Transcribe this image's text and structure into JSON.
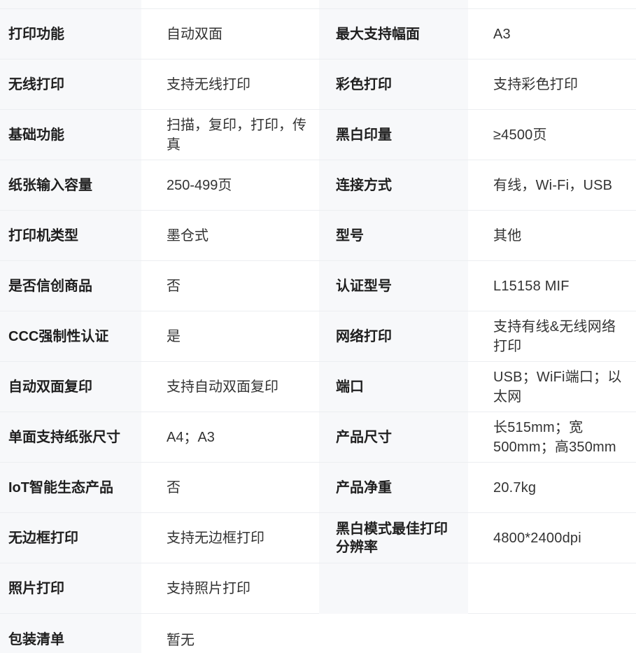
{
  "rows": [
    [
      {
        "label": "打印功能",
        "value": "自动双面"
      },
      {
        "label": "最大支持幅面",
        "value": "A3"
      }
    ],
    [
      {
        "label": "无线打印",
        "value": "支持无线打印"
      },
      {
        "label": "彩色打印",
        "value": "支持彩色打印"
      }
    ],
    [
      {
        "label": "基础功能",
        "value": "扫描，复印，打印，传真"
      },
      {
        "label": "黑白印量",
        "value": "≥4500页"
      }
    ],
    [
      {
        "label": "纸张输入容量",
        "value": "250-499页"
      },
      {
        "label": "连接方式",
        "value": "有线，Wi-Fi，USB"
      }
    ],
    [
      {
        "label": "打印机类型",
        "value": "墨仓式"
      },
      {
        "label": "型号",
        "value": "其他"
      }
    ],
    [
      {
        "label": "是否信创商品",
        "value": "否"
      },
      {
        "label": "认证型号",
        "value": "L15158 MIF"
      }
    ],
    [
      {
        "label": "CCC强制性认证",
        "value": "是"
      },
      {
        "label": "网络打印",
        "value": "支持有线&无线网络打印"
      }
    ],
    [
      {
        "label": "自动双面复印",
        "value": "支持自动双面复印"
      },
      {
        "label": "端口",
        "value": "USB；WiFi端口；以太网"
      }
    ],
    [
      {
        "label": "单面支持纸张尺寸",
        "value": "A4；A3"
      },
      {
        "label": "产品尺寸",
        "value": "长515mm；宽500mm；高350mm"
      }
    ],
    [
      {
        "label": "IoT智能生态产品",
        "value": "否"
      },
      {
        "label": "产品净重",
        "value": "20.7kg"
      }
    ],
    [
      {
        "label": "无边框打印",
        "value": "支持无边框打印"
      },
      {
        "label": "黑白模式最佳打印分辨率",
        "value": "4800*2400dpi"
      }
    ],
    [
      {
        "label": "照片打印",
        "value": "支持照片打印"
      }
    ],
    [
      {
        "label": "包装清单",
        "value": "暂无"
      }
    ]
  ]
}
